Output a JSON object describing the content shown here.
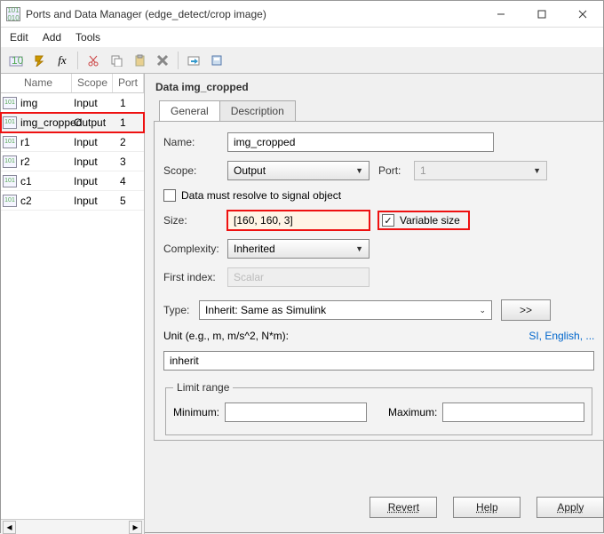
{
  "window": {
    "title": "Ports and Data Manager (edge_detect/crop image)"
  },
  "menu": {
    "edit": "Edit",
    "add": "Add",
    "tools": "Tools"
  },
  "list": {
    "headers": {
      "name": "Name",
      "scope": "Scope",
      "port": "Port"
    },
    "rows": [
      {
        "name": "img",
        "scope": "Input",
        "port": "1",
        "selected": false
      },
      {
        "name": "img_cropped",
        "scope": "Output",
        "port": "1",
        "selected": true
      },
      {
        "name": "r1",
        "scope": "Input",
        "port": "2",
        "selected": false
      },
      {
        "name": "r2",
        "scope": "Input",
        "port": "3",
        "selected": false
      },
      {
        "name": "c1",
        "scope": "Input",
        "port": "4",
        "selected": false
      },
      {
        "name": "c2",
        "scope": "Input",
        "port": "5",
        "selected": false
      }
    ]
  },
  "pane": {
    "title": "Data img_cropped",
    "tabs": {
      "general": "General",
      "description": "Description"
    },
    "labels": {
      "name": "Name:",
      "scope": "Scope:",
      "port": "Port:",
      "resolve": "Data must resolve to signal object",
      "size": "Size:",
      "varsize": "Variable size",
      "complexity": "Complexity:",
      "first": "First index:",
      "type": "Type:",
      "unit": "Unit (e.g., m, m/s^2, N*m):",
      "units_link": "SI, English, ...",
      "limit": "Limit range",
      "min": "Minimum:",
      "max": "Maximum:"
    },
    "values": {
      "name": "img_cropped",
      "scope": "Output",
      "port": "1",
      "resolve_checked": false,
      "size": "[160, 160, 3]",
      "varsize_checked": true,
      "complexity": "Inherited",
      "first_index": "Scalar",
      "type": "Inherit: Same as Simulink",
      "type_more": ">>",
      "unit": "inherit",
      "min": "",
      "max": ""
    }
  },
  "buttons": {
    "revert": "Revert",
    "help": "Help",
    "apply": "Apply"
  }
}
